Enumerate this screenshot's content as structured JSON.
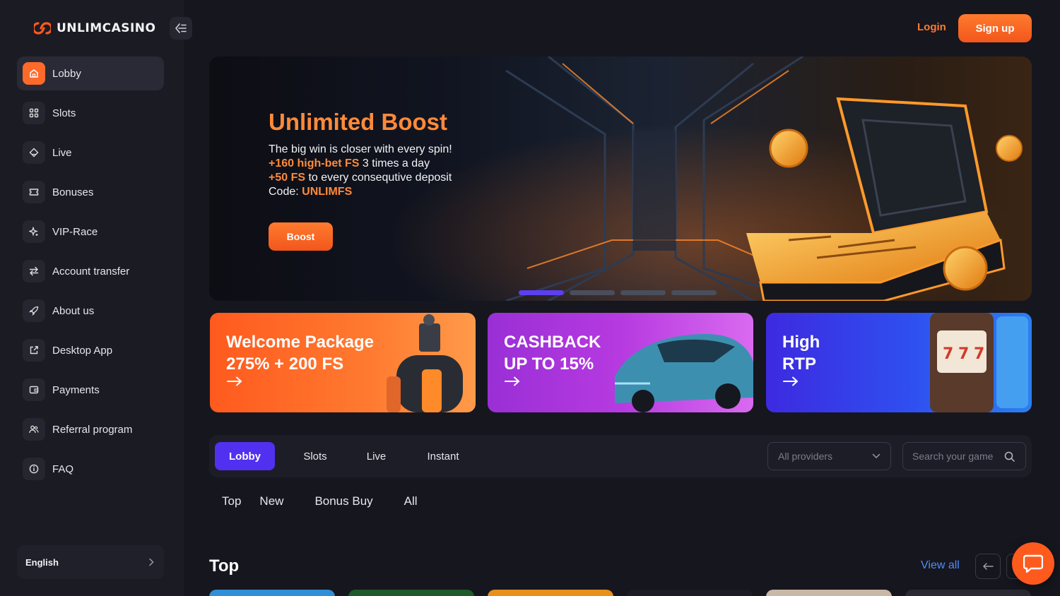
{
  "brand": {
    "name": "UNLIMCASINO",
    "accent": "#ff6a2b",
    "purple": "#5230f0"
  },
  "header": {
    "login_label": "Login",
    "signup_label": "Sign up"
  },
  "sidebar": {
    "items": [
      {
        "label": "Lobby",
        "icon": "home-icon",
        "active": true
      },
      {
        "label": "Slots",
        "icon": "grid-icon"
      },
      {
        "label": "Live",
        "icon": "diamond-icon"
      },
      {
        "label": "Bonuses",
        "icon": "ticket-icon"
      },
      {
        "label": "VIP-Race",
        "icon": "sparkle-icon"
      },
      {
        "label": "Account transfer",
        "icon": "transfer-icon"
      },
      {
        "label": "About us",
        "icon": "rocket-icon"
      },
      {
        "label": "Desktop App",
        "icon": "external-link-icon"
      },
      {
        "label": "Payments",
        "icon": "wallet-icon"
      },
      {
        "label": "Referral program",
        "icon": "users-icon"
      },
      {
        "label": "FAQ",
        "icon": "info-icon"
      }
    ],
    "language": "English"
  },
  "hero": {
    "title": "Unlimited Boost",
    "line1": "The big win is closer with every spin!",
    "line2_highlight": "+160 high-bet FS",
    "line2_rest": " 3 times a day",
    "line3_highlight": "+50 FS",
    "line3_rest": " to every consequtive deposit",
    "line4_prefix": "Code: ",
    "line4_code": "UNLIMFS",
    "button_label": "Boost",
    "slides_total": 4,
    "active_slide": 1
  },
  "promos": [
    {
      "line1": "Welcome Package",
      "line2": "275% + 200 FS",
      "arrow": "→"
    },
    {
      "line1": "CASHBACK",
      "line2": "UP TO 15%",
      "arrow": "→"
    },
    {
      "line1": "High",
      "line2": "RTP",
      "arrow": "→"
    }
  ],
  "game_tabs": {
    "tabs": [
      "Lobby",
      "Slots",
      "Live",
      "Instant"
    ],
    "active": "Lobby",
    "providers_selected": "All providers",
    "search_placeholder": "Search your game"
  },
  "sub_tabs": [
    "Top",
    "New",
    "Bonus Buy",
    "All"
  ],
  "section": {
    "title": "Top",
    "view_all_label": "View all"
  }
}
